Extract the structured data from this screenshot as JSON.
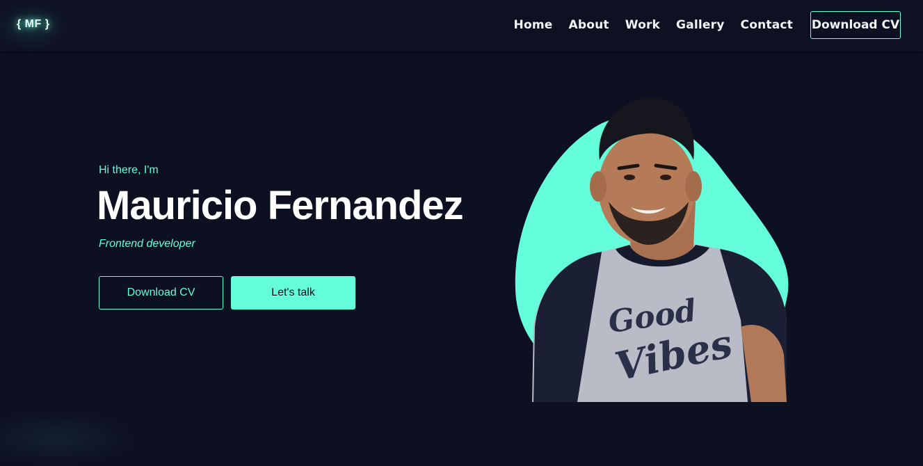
{
  "logo": {
    "text": "{ MF }"
  },
  "nav": {
    "links": [
      "Home",
      "About",
      "Work",
      "Gallery",
      "Contact"
    ],
    "cv_button": "Download CV"
  },
  "hero": {
    "greeting": "Hi there, I'm",
    "name": "Mauricio Fernandez",
    "role": "Frontend developer",
    "buttons": {
      "download_cv": "Download CV",
      "lets_talk": "Let's talk"
    },
    "shirt_print": [
      "Good",
      "Vibes"
    ]
  },
  "colors": {
    "background": "#0d1021",
    "accent": "#64ffda",
    "text": "#ffffff"
  }
}
